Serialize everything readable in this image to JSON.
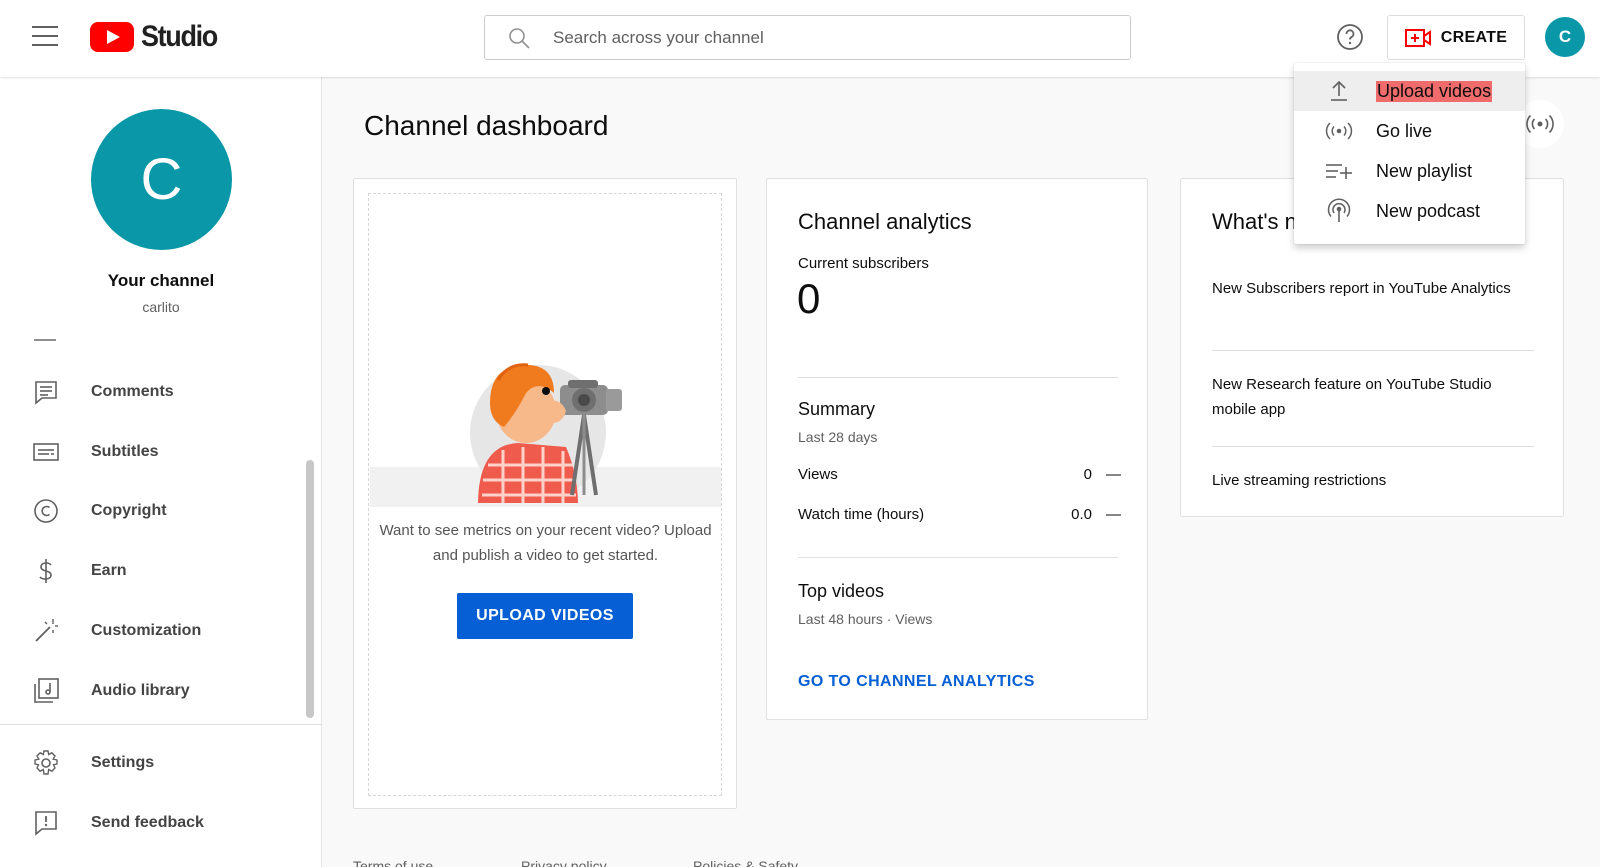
{
  "header": {
    "logo_text": "Studio",
    "search_placeholder": "Search across your channel",
    "create_label": "CREATE",
    "avatar_letter": "C"
  },
  "sidebar": {
    "avatar_letter": "C",
    "channel_label": "Your channel",
    "handle": "carlito",
    "items": [
      {
        "label": "Comments",
        "icon": "comments-icon"
      },
      {
        "label": "Subtitles",
        "icon": "subtitles-icon"
      },
      {
        "label": "Copyright",
        "icon": "copyright-icon"
      },
      {
        "label": "Earn",
        "icon": "dollar-icon"
      },
      {
        "label": "Customization",
        "icon": "magic-wand-icon"
      },
      {
        "label": "Audio library",
        "icon": "audio-library-icon"
      }
    ],
    "bottom_items": [
      {
        "label": "Settings",
        "icon": "gear-icon"
      },
      {
        "label": "Send feedback",
        "icon": "feedback-icon"
      }
    ]
  },
  "main": {
    "title": "Channel dashboard",
    "upload_card": {
      "message": "Want to see metrics on your recent video? Upload and publish a video to get started.",
      "button": "UPLOAD VIDEOS"
    },
    "analytics": {
      "title": "Channel analytics",
      "subscribers_label": "Current subscribers",
      "subscribers_value": "0",
      "summary_title": "Summary",
      "summary_period": "Last 28 days",
      "rows": [
        {
          "label": "Views",
          "value": "0",
          "delta": "—"
        },
        {
          "label": "Watch time (hours)",
          "value": "0.0",
          "delta": "—"
        }
      ],
      "top_videos_title": "Top videos",
      "top_videos_period": "Last 48 hours · Views",
      "link": "GO TO CHANNEL ANALYTICS"
    },
    "whats_new": {
      "title": "What's new in Studio",
      "items": [
        "New Subscribers report in YouTube Analytics",
        "New Research feature on YouTube Studio mobile app",
        "Live streaming restrictions"
      ]
    }
  },
  "footer": {
    "links": [
      "Terms of use",
      "Privacy policy",
      "Policies & Safety"
    ]
  },
  "create_menu": {
    "items": [
      {
        "label": "Upload videos",
        "icon": "upload-icon",
        "highlighted": true
      },
      {
        "label": "Go live",
        "icon": "live-icon"
      },
      {
        "label": "New playlist",
        "icon": "playlist-add-icon"
      },
      {
        "label": "New podcast",
        "icon": "podcast-icon"
      }
    ]
  },
  "colors": {
    "brand_red": "#ff0000",
    "avatar_teal": "#0a97a7",
    "link_blue": "#065fd4",
    "menu_highlight": "#f06b6b"
  }
}
